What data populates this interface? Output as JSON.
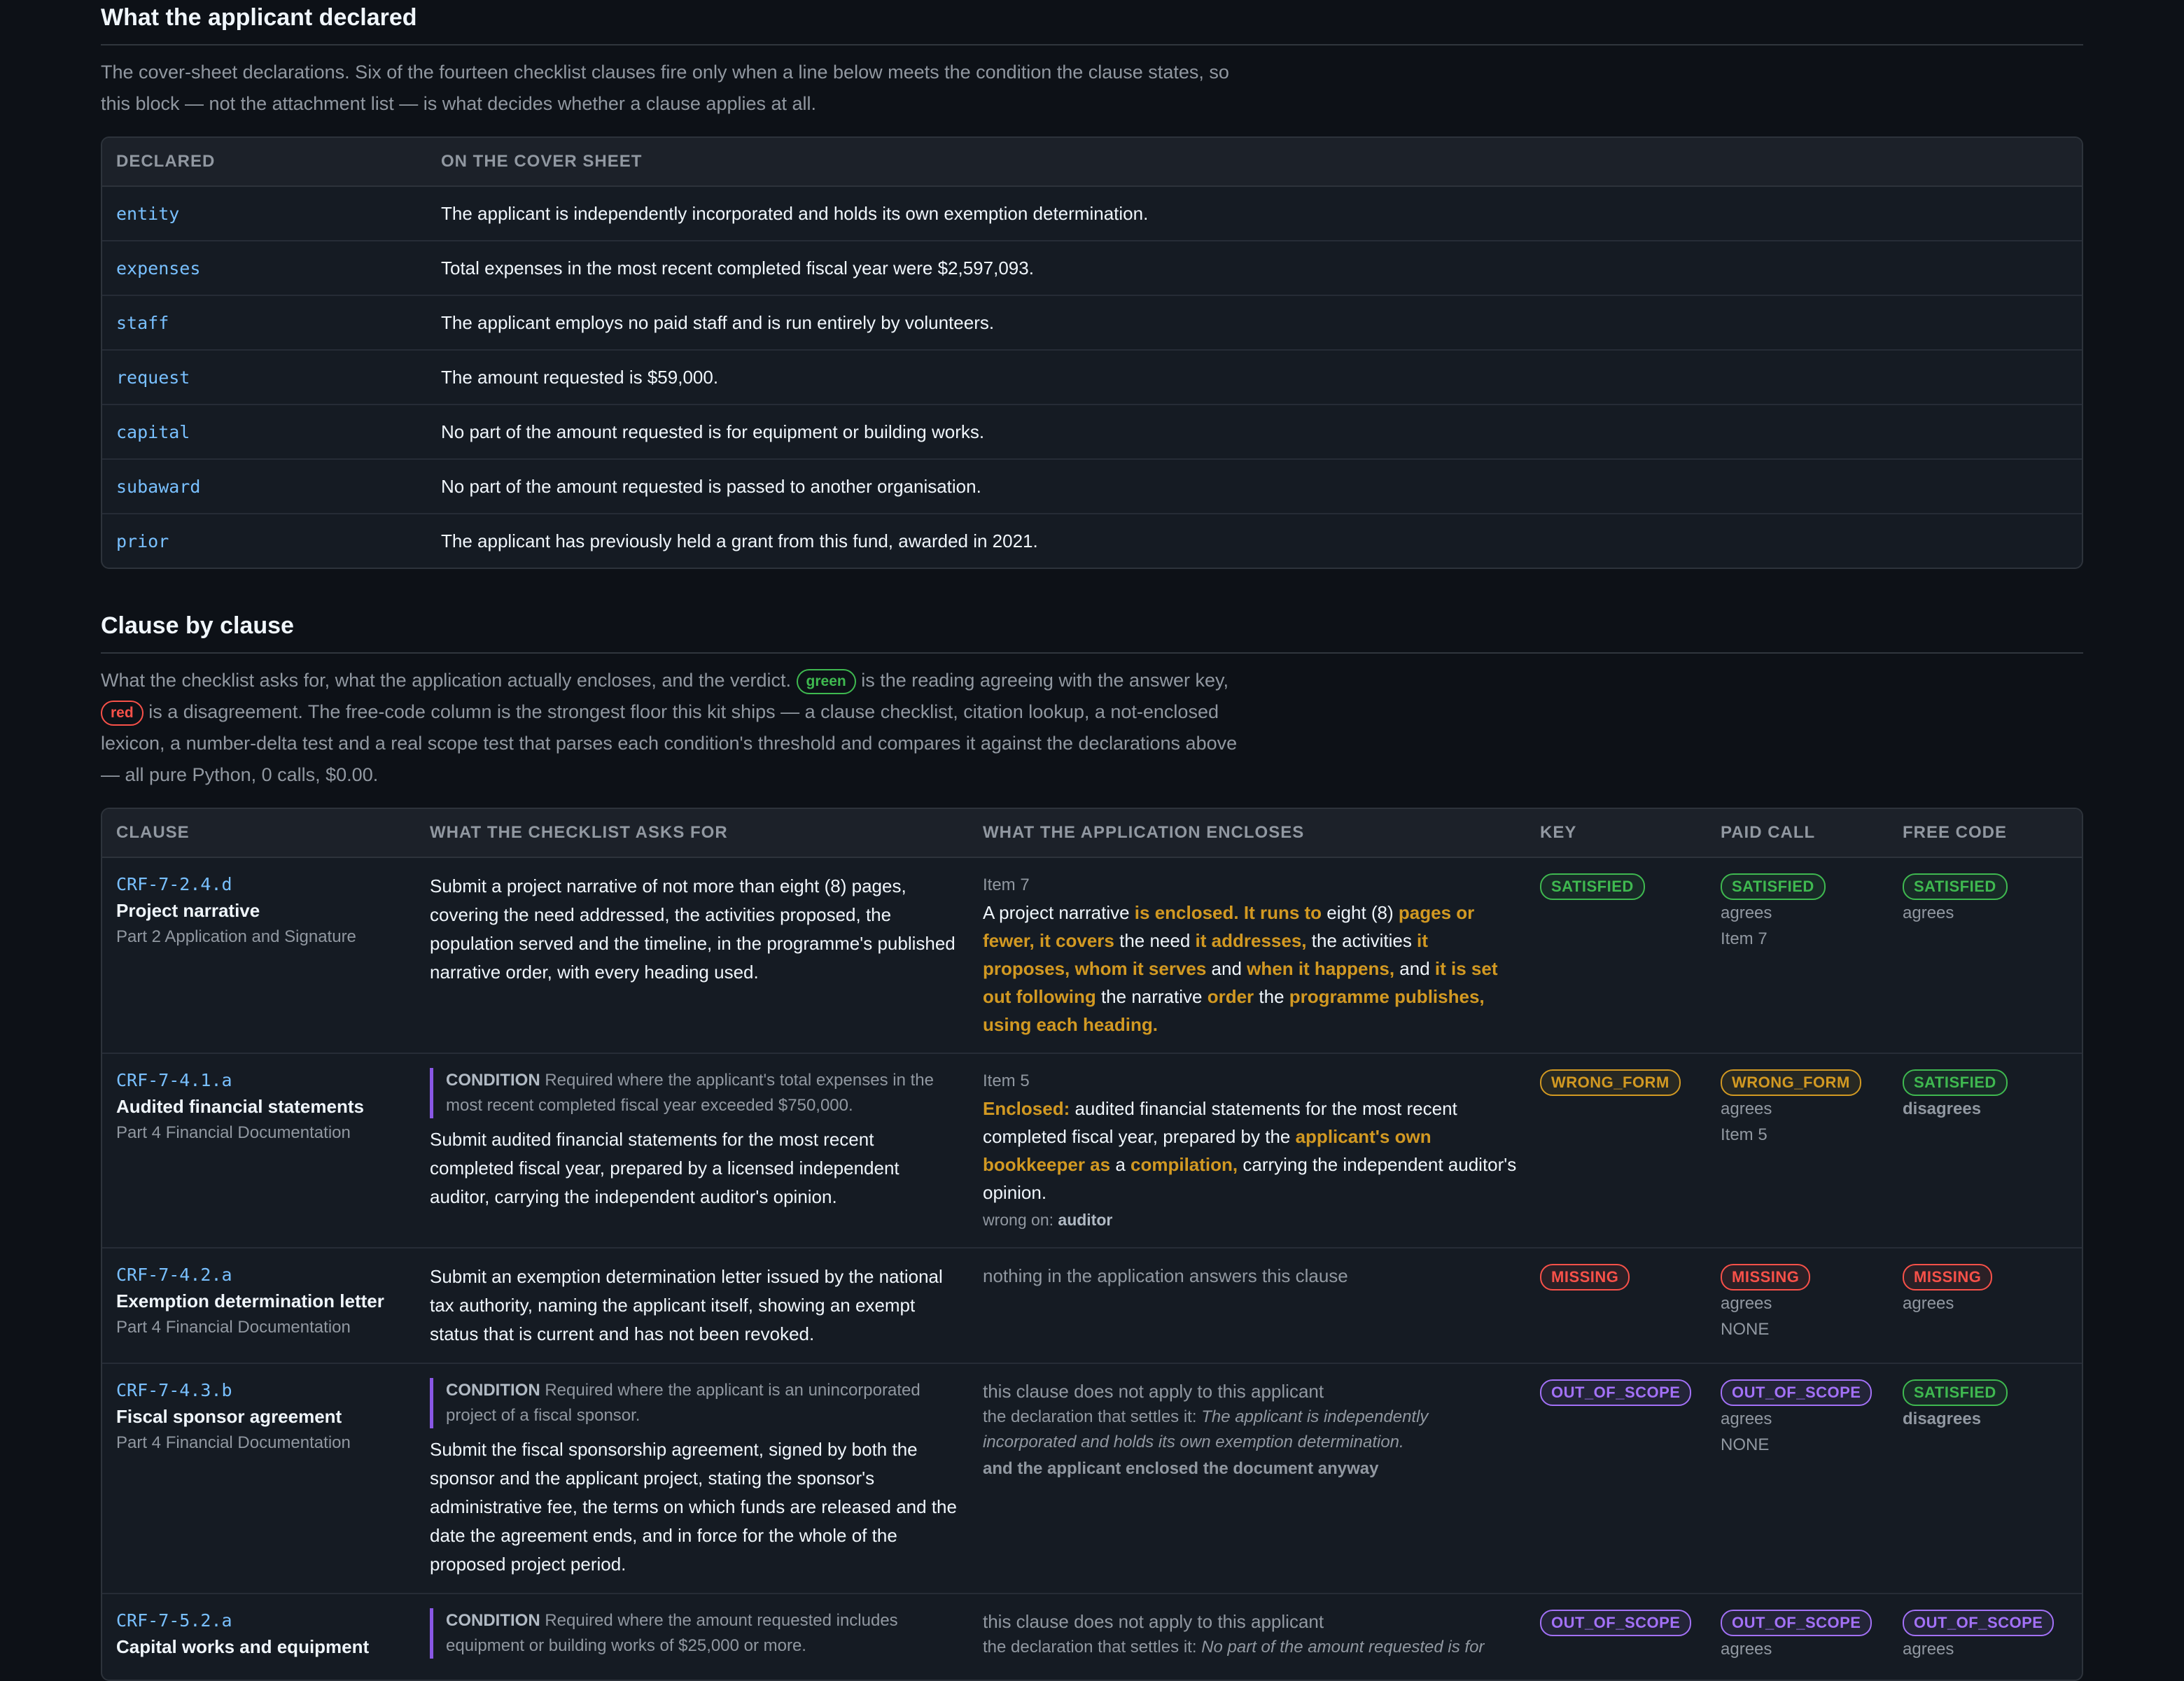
{
  "declared_section": {
    "title": "What the applicant declared",
    "intro": "The cover-sheet declarations. Six of the fourteen checklist clauses fire only when a line below meets the condition the clause states, so this block — not the attachment list — is what decides whether a clause applies at all.",
    "headers": [
      "DECLARED",
      "ON THE COVER SHEET"
    ],
    "rows": [
      {
        "key": "entity",
        "value": "The applicant is independently incorporated and holds its own exemption determination."
      },
      {
        "key": "expenses",
        "value": "Total expenses in the most recent completed fiscal year were $2,597,093."
      },
      {
        "key": "staff",
        "value": "The applicant employs no paid staff and is run entirely by volunteers."
      },
      {
        "key": "request",
        "value": "The amount requested is $59,000."
      },
      {
        "key": "capital",
        "value": "No part of the amount requested is for equipment or building works."
      },
      {
        "key": "subaward",
        "value": "No part of the amount requested is passed to another organisation."
      },
      {
        "key": "prior",
        "value": "The applicant has previously held a grant from this fund, awarded in 2021."
      }
    ]
  },
  "clause_section": {
    "title": "Clause by clause",
    "intro_a": "What the checklist asks for, what the application actually encloses, and the verdict.",
    "green_label": "green",
    "intro_b": "is the reading agreeing with the answer key,",
    "red_label": "red",
    "intro_c": "is a disagreement. The free-code column is the strongest floor this kit ships — a clause checklist, citation lookup, a not-enclosed lexicon, a number-delta test and a real scope test that parses each condition's threshold and compares it against the declarations above — all pure Python, 0 calls, $0.00.",
    "headers": [
      "CLAUSE",
      "WHAT THE CHECKLIST ASKS FOR",
      "WHAT THE APPLICATION ENCLOSES",
      "KEY",
      "PAID CALL",
      "FREE CODE"
    ],
    "condition_label": "CONDITION",
    "rows": [
      {
        "id": "CRF-7-2.4.d",
        "title": "Project narrative",
        "part": "Part 2 Application and Signature",
        "ask": "Submit a project narrative of not more than eight (8) pages, covering the need addressed, the activities proposed, the population served and the timeline, in the programme's published narrative order, with every heading used.",
        "item": "Item 7",
        "enc": [
          {
            "t": "A project narrative ",
            "h": false
          },
          {
            "t": "is enclosed. It runs to",
            "h": true
          },
          {
            "t": " eight (8) ",
            "h": false
          },
          {
            "t": "pages or fewer, it covers",
            "h": true
          },
          {
            "t": " the need ",
            "h": false
          },
          {
            "t": "it addresses,",
            "h": true
          },
          {
            "t": " the activities ",
            "h": false
          },
          {
            "t": "it proposes, whom it serves",
            "h": true
          },
          {
            "t": " and ",
            "h": false
          },
          {
            "t": "when it happens,",
            "h": true
          },
          {
            "t": " and ",
            "h": false
          },
          {
            "t": "it is set out following",
            "h": true
          },
          {
            "t": " the narrative ",
            "h": false
          },
          {
            "t": "order",
            "h": true
          },
          {
            "t": " the ",
            "h": false
          },
          {
            "t": "programme publishes, using each heading.",
            "h": true
          }
        ],
        "key": "SATISFIED",
        "paid": "SATISFIED",
        "paid_note": "agrees",
        "paid_ref": "Item 7",
        "free": "SATISFIED",
        "free_note": "agrees"
      },
      {
        "id": "CRF-7-4.1.a",
        "title": "Audited financial statements",
        "part": "Part 4 Financial Documentation",
        "condition": "Required where the applicant's total expenses in the most recent completed fiscal year exceeded $750,000.",
        "ask": "Submit audited financial statements for the most recent completed fiscal year, prepared by a licensed independent auditor, carrying the independent auditor's opinion.",
        "item": "Item 5",
        "enc": [
          {
            "t": "Enclosed:",
            "h": true
          },
          {
            "t": " audited financial statements for the most recent completed fiscal year, prepared by the ",
            "h": false
          },
          {
            "t": "applicant's own bookkeeper as",
            "h": true
          },
          {
            "t": " a ",
            "h": false
          },
          {
            "t": "compilation,",
            "h": true
          },
          {
            "t": " carrying the independent auditor's opinion.",
            "h": false
          }
        ],
        "wrong_on_label": "wrong on:",
        "wrong_on": "auditor",
        "key": "WRONG_FORM",
        "paid": "WRONG_FORM",
        "paid_note": "agrees",
        "paid_ref": "Item 5",
        "free": "SATISFIED",
        "free_note": "disagrees"
      },
      {
        "id": "CRF-7-4.2.a",
        "title": "Exemption determination letter",
        "part": "Part 4 Financial Documentation",
        "ask": "Submit an exemption determination letter issued by the national tax authority, naming the applicant itself, showing an exempt status that is current and has not been revoked.",
        "muted": "nothing in the application answers this clause",
        "key": "MISSING",
        "paid": "MISSING",
        "paid_note": "agrees",
        "paid_ref": "NONE",
        "free": "MISSING",
        "free_note": "agrees"
      },
      {
        "id": "CRF-7-4.3.b",
        "title": "Fiscal sponsor agreement",
        "part": "Part 4 Financial Documentation",
        "condition": "Required where the applicant is an unincorporated project of a fiscal sponsor.",
        "ask": "Submit the fiscal sponsorship agreement, signed by both the sponsor and the applicant project, stating the sponsor's administrative fee, the terms on which funds are released and the date the agreement ends, and in force for the whole of the proposed project period.",
        "muted": "this clause does not apply to this applicant",
        "settle_label": "the declaration that settles it:",
        "settle": "The applicant is independently incorporated and holds its own exemption determination.",
        "anyway": "and the applicant enclosed the document anyway",
        "key": "OUT_OF_SCOPE",
        "paid": "OUT_OF_SCOPE",
        "paid_note": "agrees",
        "paid_ref": "NONE",
        "free": "SATISFIED",
        "free_note": "disagrees"
      },
      {
        "id": "CRF-7-5.2.a",
        "title": "Capital works and equipment",
        "part": "",
        "condition": "Required where the amount requested includes equipment or building works of $25,000 or more.",
        "muted": "this clause does not apply to this applicant",
        "settle_label": "the declaration that settles it:",
        "settle": "No part of the amount requested is for",
        "key": "OUT_OF_SCOPE",
        "paid": "OUT_OF_SCOPE",
        "paid_note": "agrees",
        "free": "OUT_OF_SCOPE",
        "free_note": "agrees"
      }
    ]
  },
  "colors": {
    "background": "#0d1117",
    "satisfied": "#3fb950",
    "wrong_form": "#d29922",
    "missing": "#f85149",
    "out_of_scope": "#a371f7",
    "code": "#79c0ff"
  }
}
